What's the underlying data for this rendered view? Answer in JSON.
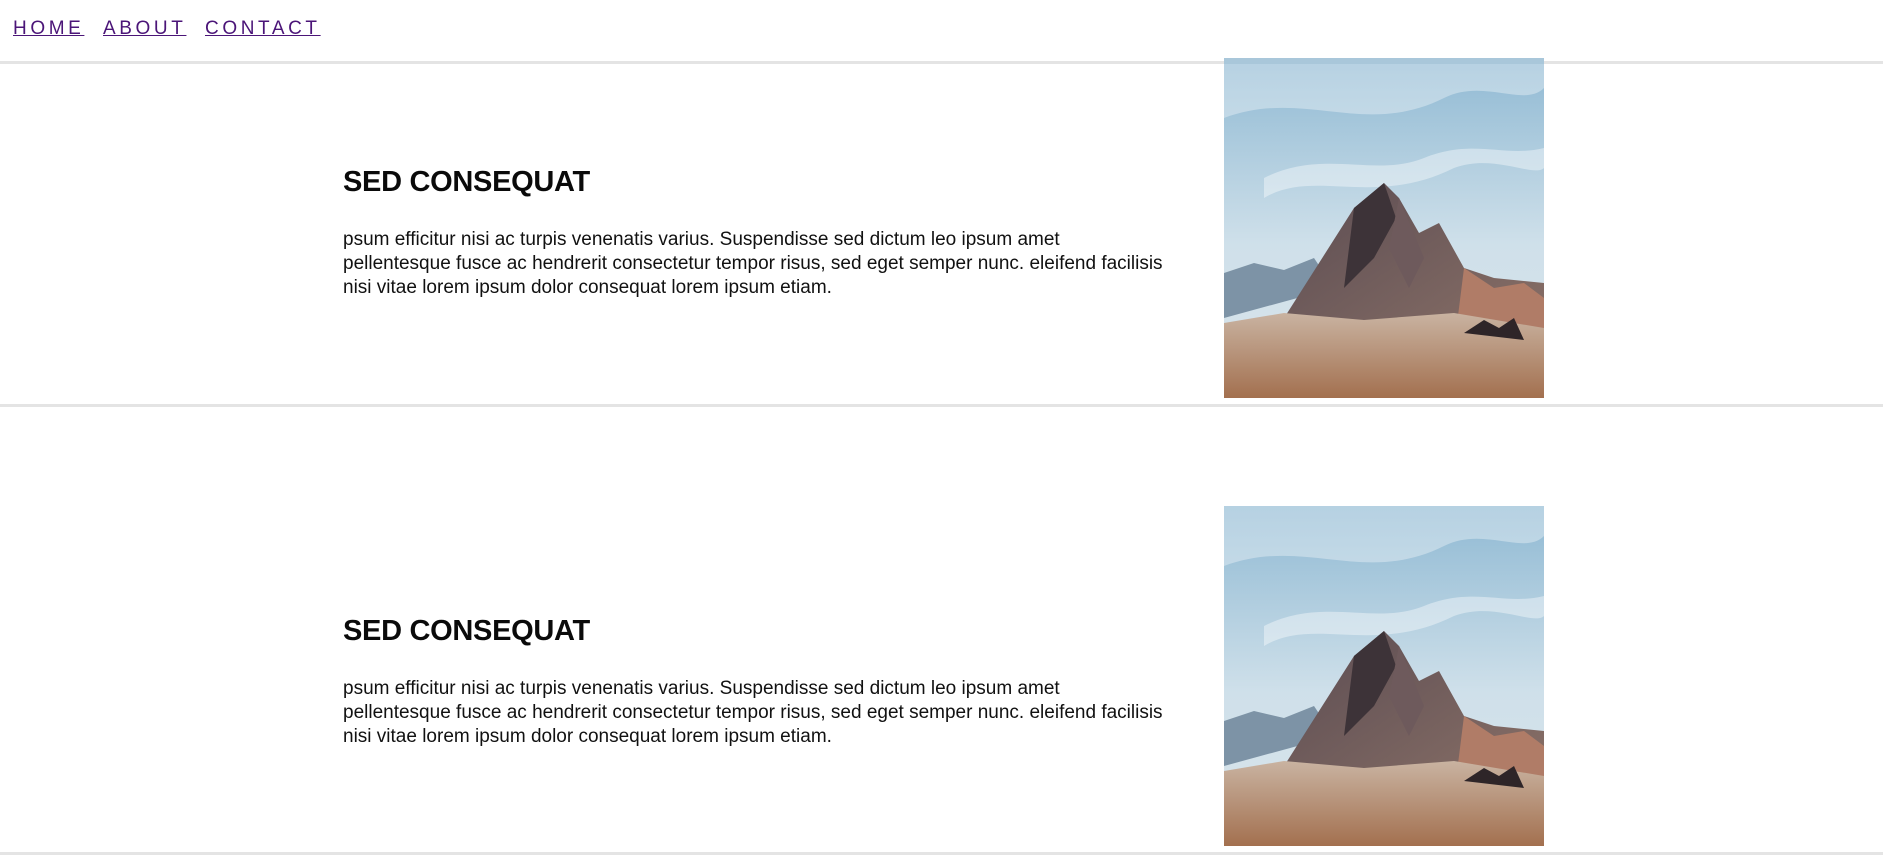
{
  "nav": {
    "items": [
      {
        "label": "HOME"
      },
      {
        "label": "ABOUT"
      },
      {
        "label": "CONTACT"
      }
    ]
  },
  "sections": [
    {
      "title": "SED CONSEQUAT",
      "body": "psum efficitur nisi ac turpis venenatis varius. Suspendisse sed dictum leo ipsum amet pellentesque fusce ac hendrerit consectetur tempor risus, sed eget semper nunc. eleifend facilisis nisi vitae lorem ipsum dolor consequat lorem ipsum etiam."
    },
    {
      "title": "SED CONSEQUAT",
      "body": "psum efficitur nisi ac turpis venenatis varius. Suspendisse sed dictum leo ipsum amet pellentesque fusce ac hendrerit consectetur tempor risus, sed eget semper nunc. eleifend facilisis nisi vitae lorem ipsum dolor consequat lorem ipsum etiam."
    }
  ],
  "colors": {
    "link": "#4b1578",
    "divider": "#e4e4e4",
    "heading": "#0a0a0a"
  }
}
